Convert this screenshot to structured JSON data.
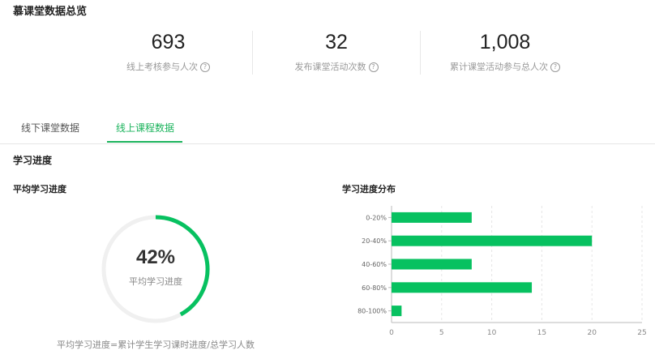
{
  "overview": {
    "title": "慕课堂数据总览",
    "stats": [
      {
        "value": "693",
        "label": "线上考核参与人次"
      },
      {
        "value": "32",
        "label": "发布课堂活动次数"
      },
      {
        "value": "1,008",
        "label": "累计课堂活动参与总人次"
      }
    ],
    "help_glyph": "?"
  },
  "tabs": [
    {
      "label": "线下课堂数据",
      "active": false
    },
    {
      "label": "线上课程数据",
      "active": true
    }
  ],
  "section": {
    "title": "学习进度",
    "avg_title": "平均学习进度",
    "dist_title": "学习进度分布"
  },
  "progress": {
    "value": "42%",
    "fraction": 0.42,
    "label": "平均学习进度",
    "formula": "平均学习进度=累计学生学习课时进度/总学习人数"
  },
  "colors": {
    "accent": "#1bb35c",
    "bar": "#07c160",
    "ring_track": "#f0f0f0"
  },
  "chart_data": {
    "type": "bar",
    "orientation": "horizontal",
    "categories": [
      "0-20%",
      "20-40%",
      "40-60%",
      "60-80%",
      "80-100%"
    ],
    "values": [
      8,
      20,
      8,
      14,
      1
    ],
    "xlim": [
      0,
      25
    ],
    "xticks": [
      "0",
      "5",
      "10",
      "15",
      "20",
      "25"
    ],
    "grid": true
  }
}
